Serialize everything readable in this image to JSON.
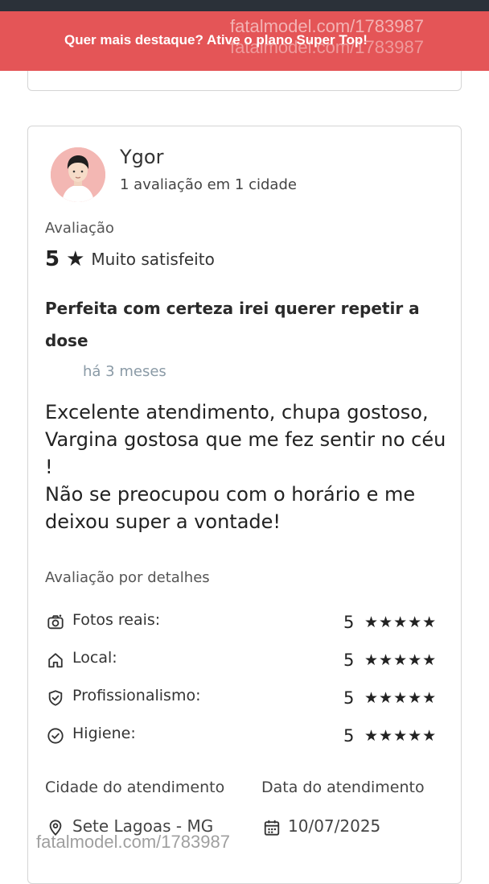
{
  "promo": {
    "text": "Quer mais destaque? Ative o plano Super Top!",
    "watermark_top_1": "fatalmodel.com/1783987",
    "watermark_top_2": "fatalmodel.com/1783987"
  },
  "review": {
    "user": {
      "name": "Ygor",
      "stats": "1 avaliação em 1 cidade"
    },
    "rating_label": "Avaliação",
    "rating_value": "5",
    "rating_star": "★",
    "rating_text": "Muito satisfeito",
    "title": "Perfeita com certeza irei querer repetir a dose",
    "date": "há 3 meses",
    "body": "Excelente atendimento, chupa gostoso, Vargina gostosa que me fez sentir no céu !\nNão se preocupou com o horário e me deixou super a vontade!",
    "details_label": "Avaliação por detalhes",
    "details": [
      {
        "label": "Fotos reais:",
        "score": "5",
        "stars": "★★★★★",
        "icon": "camera-icon"
      },
      {
        "label": "Local:",
        "score": "5",
        "stars": "★★★★★",
        "icon": "home-icon"
      },
      {
        "label": "Profissionalismo:",
        "score": "5",
        "stars": "★★★★★",
        "icon": "shield-check-icon"
      },
      {
        "label": "Higiene:",
        "score": "5",
        "stars": "★★★★★",
        "icon": "check-circle-icon"
      }
    ],
    "city_label": "Cidade do atendimento",
    "city_value": "Sete Lagoas - MG",
    "date_label": "Data do atendimento",
    "date_value": "10/07/2025",
    "watermark_bottom": "fatalmodel.com/1783987"
  },
  "colors": {
    "promo_bg": "#e45557",
    "topbar": "#2b3139",
    "date_text": "#8a9aa6"
  }
}
